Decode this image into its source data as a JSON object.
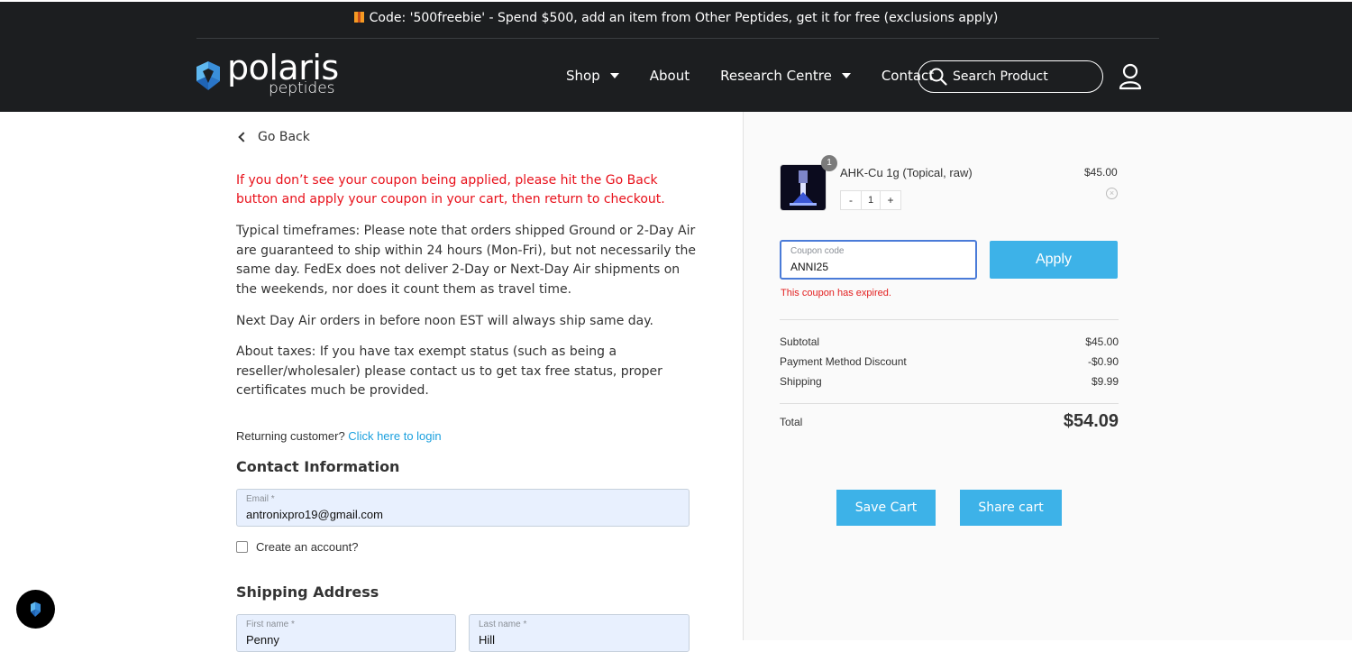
{
  "promo": {
    "text": "Code: '500freebie' - Spend $500, add an item from Other Peptides, get it for free (exclusions apply)",
    "icon": "gift-icon"
  },
  "brand": {
    "name": "polaris",
    "sub": "peptides",
    "colors": {
      "mark_light": "#5fb8ef",
      "mark_dark": "#1f64b5"
    }
  },
  "nav": {
    "items": [
      {
        "label": "Shop",
        "dropdown": true
      },
      {
        "label": "About",
        "dropdown": false
      },
      {
        "label": "Research Centre",
        "dropdown": true
      },
      {
        "label": "Contact",
        "dropdown": false
      }
    ],
    "search_placeholder": "Search Product"
  },
  "left": {
    "go_back": "Go Back",
    "warning": "If you don’t see your coupon being applied, please hit the Go Back button and apply your coupon in your cart, then return to checkout.",
    "info": [
      "Typical timeframes: Please note that orders shipped Ground or 2-Day Air are guaranteed to ship within 24 hours (Mon-Fri), but not necessarily the same day. FedEx does not deliver 2-Day or Next-Day Air shipments on the weekends, nor does it count them as travel time.",
      "Next Day Air orders in before noon EST will always ship same day.",
      "About taxes: If you have tax exempt status (such as being a reseller/wholesaler) please contact us to get tax free status, proper certificates much be provided."
    ],
    "returning_text": "Returning customer?",
    "login_link": "Click here to login",
    "contact_heading": "Contact Information",
    "email_label": "Email *",
    "email_value": "antronixpro19@gmail.com",
    "create_account": "Create an account?",
    "shipping_heading": "Shipping Address",
    "first_name_label": "First name *",
    "first_name_value": "Penny",
    "last_name_label": "Last name *",
    "last_name_value": "Hill"
  },
  "cart": {
    "item": {
      "name": "AHK-Cu 1g (Topical, raw)",
      "price": "$45.00",
      "qty": "1",
      "badge": "1"
    },
    "coupon_label": "Coupon code",
    "coupon_value": "ANNI25",
    "apply_label": "Apply",
    "coupon_error": "This coupon has expired.",
    "subtotal_label": "Subtotal",
    "subtotal_value": "$45.00",
    "discount_label": "Payment Method Discount",
    "discount_value": "-$0.90",
    "shipping_label": "Shipping",
    "shipping_value": "$9.99",
    "total_label": "Total",
    "total_value": "$54.09",
    "save_cart": "Save Cart",
    "share_cart": "Share cart"
  },
  "colors": {
    "accent": "#3db2e8",
    "error": "#e8101a",
    "header_bg": "#1c1e20"
  }
}
